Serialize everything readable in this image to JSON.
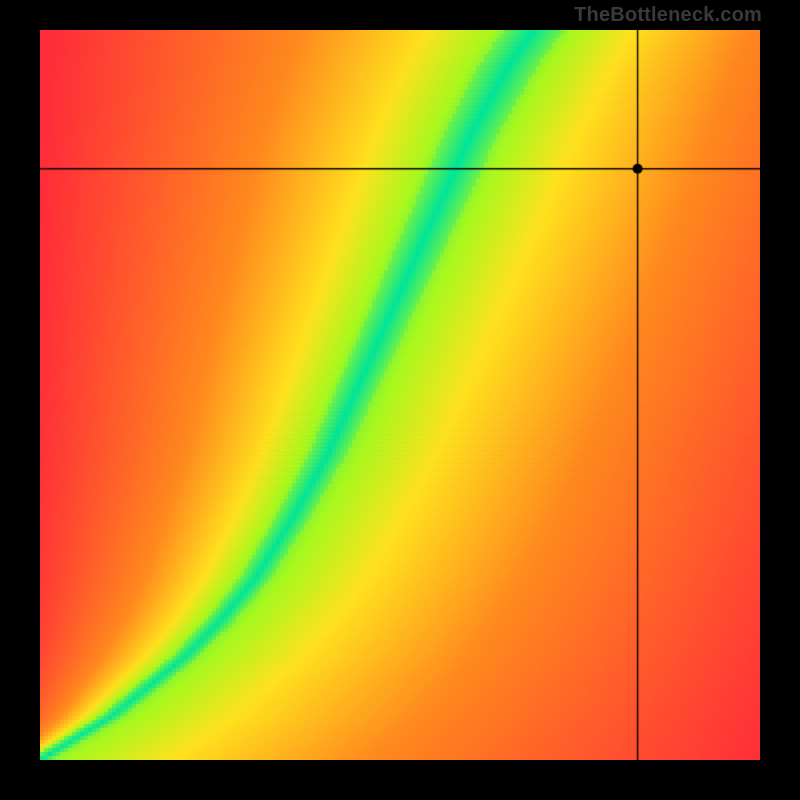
{
  "watermark": {
    "text": "TheBottleneck.com"
  },
  "chart_data": {
    "type": "heatmap",
    "title": "",
    "xlabel": "",
    "ylabel": "",
    "xlim": [
      0,
      1
    ],
    "ylim": [
      0,
      1
    ],
    "width_cells": 180,
    "height_cells": 182,
    "marker": {
      "x": 0.83,
      "y": 0.81
    },
    "ridge": [
      {
        "x": 0.0,
        "y": 0.0
      },
      {
        "x": 0.05,
        "y": 0.03
      },
      {
        "x": 0.1,
        "y": 0.06
      },
      {
        "x": 0.15,
        "y": 0.1
      },
      {
        "x": 0.2,
        "y": 0.14
      },
      {
        "x": 0.25,
        "y": 0.19
      },
      {
        "x": 0.3,
        "y": 0.25
      },
      {
        "x": 0.35,
        "y": 0.33
      },
      {
        "x": 0.4,
        "y": 0.42
      },
      {
        "x": 0.45,
        "y": 0.53
      },
      {
        "x": 0.5,
        "y": 0.64
      },
      {
        "x": 0.55,
        "y": 0.75
      },
      {
        "x": 0.6,
        "y": 0.86
      },
      {
        "x": 0.65,
        "y": 0.95
      },
      {
        "x": 0.7,
        "y": 1.02
      }
    ],
    "band_width": 0.06,
    "colors": {
      "hot": "#ff2d3a",
      "warm": "#ff8a1e",
      "mid": "#ffe21e",
      "cool": "#a8f91e",
      "cold": "#00e59a"
    }
  }
}
